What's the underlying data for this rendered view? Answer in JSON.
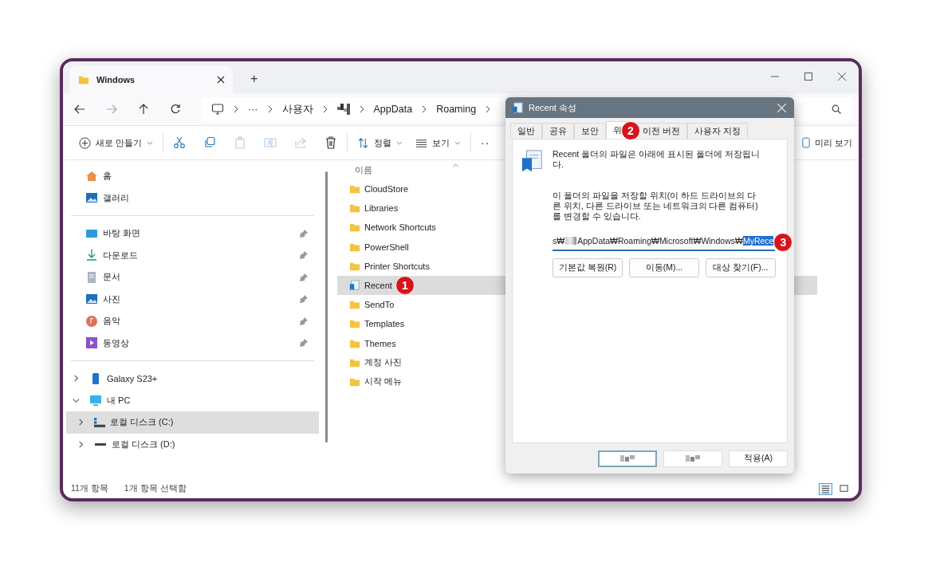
{
  "window": {
    "tab_title": "Windows",
    "new_tab": "+"
  },
  "address_bar": {
    "crumbs": [
      {
        "kind": "ellipsis",
        "label": "···"
      },
      {
        "kind": "text",
        "label": "사용자"
      },
      {
        "kind": "redacted"
      },
      {
        "kind": "text",
        "label": "AppData"
      },
      {
        "kind": "text",
        "label": "Roaming"
      }
    ]
  },
  "toolbar": {
    "new_label": "새로 만들기",
    "actions": [
      {
        "disabled": false
      },
      {
        "disabled": false
      },
      {
        "disabled": true
      },
      {
        "disabled": true
      },
      {
        "disabled": true
      },
      {
        "disabled": false
      }
    ],
    "sort_label": "정렬",
    "view_label": "보기",
    "more": "··",
    "preview_label": "미리 보기"
  },
  "sidebar": {
    "quick": [
      {
        "kind": "home",
        "label": "홈"
      },
      {
        "kind": "gallery",
        "label": "갤러리"
      }
    ],
    "pinned": [
      {
        "kind": "desktop",
        "label": "바탕 화면",
        "pinned": true
      },
      {
        "kind": "downloads",
        "label": "다운로드",
        "pinned": true
      },
      {
        "kind": "documents",
        "label": "문서",
        "pinned": true
      },
      {
        "kind": "pictures",
        "label": "사진",
        "pinned": true
      },
      {
        "kind": "music",
        "label": "음악",
        "pinned": true
      },
      {
        "kind": "videos",
        "label": "동영상",
        "pinned": true
      }
    ],
    "devices": [
      {
        "kind": "phone",
        "label": "Galaxy S23+",
        "expanded": false,
        "selected": false
      },
      {
        "kind": "pc",
        "label": "내 PC",
        "expanded": true,
        "selected": false,
        "children": [
          {
            "kind": "system",
            "label": "로컬 디스크 (C:)",
            "expanded": false,
            "selected": true
          },
          {
            "kind": "drive",
            "label": "로컬 디스크 (D:)",
            "expanded": false,
            "selected": false
          }
        ]
      }
    ]
  },
  "files": {
    "column": "이름",
    "rows": [
      {
        "kind": "folder",
        "name": "CloudStore",
        "selected": false
      },
      {
        "kind": "folder",
        "name": "Libraries",
        "selected": false
      },
      {
        "kind": "folder",
        "name": "Network Shortcuts",
        "selected": false
      },
      {
        "kind": "folder",
        "name": "PowerShell",
        "selected": false
      },
      {
        "kind": "folder",
        "name": "Printer Shortcuts",
        "selected": false
      },
      {
        "kind": "special",
        "name": "Recent",
        "selected": true,
        "badge": "1"
      },
      {
        "kind": "folder",
        "name": "SendTo",
        "selected": false
      },
      {
        "kind": "folder",
        "name": "Templates",
        "selected": false
      },
      {
        "kind": "folder",
        "name": "Themes",
        "selected": false
      },
      {
        "kind": "folder",
        "name": "계정 사진",
        "selected": false
      },
      {
        "kind": "folder",
        "name": "시작 메뉴",
        "selected": false
      }
    ]
  },
  "status_bar": {
    "count": "11개 항목",
    "selection": "1개 항목 선택함",
    "view_buttons": [
      {
        "selected": true
      },
      {
        "selected": false
      }
    ]
  },
  "dialog": {
    "title": "Recent 속성",
    "tabs": [
      {
        "label": "일반",
        "selected": false
      },
      {
        "label": "공유",
        "selected": false
      },
      {
        "label": "보안",
        "selected": false
      },
      {
        "label": "위",
        "selected": true,
        "badge": "2"
      },
      {
        "label": "이전 버전",
        "selected": false
      },
      {
        "label": "사용자 지정",
        "selected": false
      }
    ],
    "description": "Recent 폴더의 파일은 아래에 표시된 폴더에 저장됩니다.",
    "info": "이 폴더의 파일을 저장할 위치(이 하드 드라이브의 다른 위치, 다른 드라이브 또는 네트워크의 다른 컴퓨터)를 변경할 수 있습니다.",
    "path": {
      "prefix": "s₩",
      "value": "AppData₩Roaming₩Microsoft₩Windows₩",
      "selected_text": "MyRece",
      "badge": "3"
    },
    "buttons": [
      "기본값 복원(R)",
      "이동(M)...",
      "대상 찾기(F)..."
    ],
    "footer": [
      {
        "kind": "redacted",
        "focused": true
      },
      {
        "kind": "redacted",
        "focused": false
      },
      {
        "kind": "text",
        "label": "적용(A)",
        "focused": false
      }
    ]
  }
}
